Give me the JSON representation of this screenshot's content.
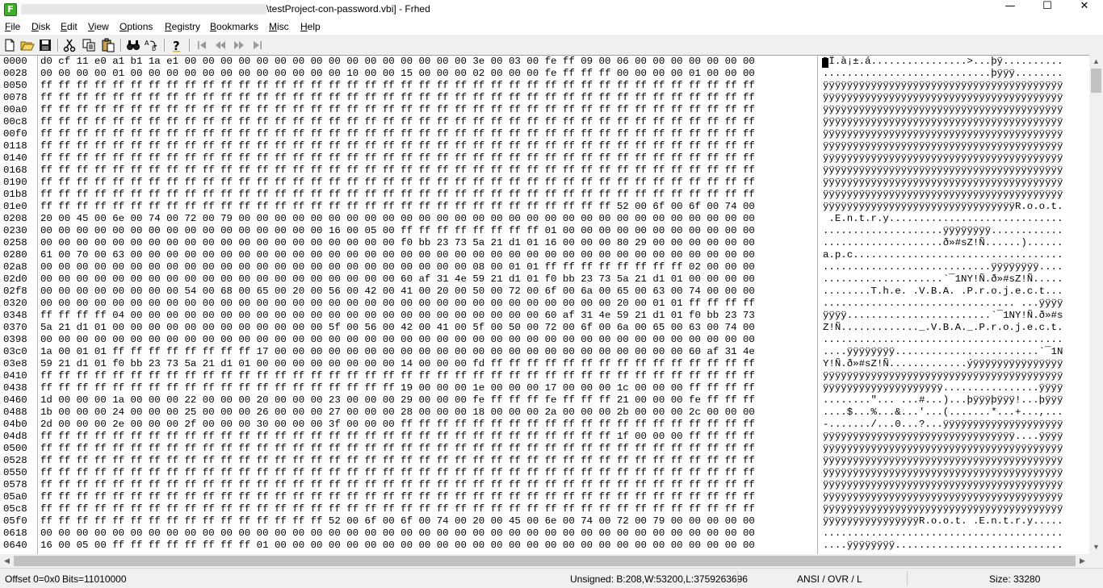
{
  "window": {
    "title": "\\testProject-con-password.vbi] - Frhed",
    "controls": {
      "minimize": "—",
      "maximize": "☐",
      "close": "✕"
    }
  },
  "menu": [
    {
      "label": "File",
      "u": "F",
      "rest": "ile"
    },
    {
      "label": "Disk",
      "u": "D",
      "rest": "isk"
    },
    {
      "label": "Edit",
      "u": "E",
      "rest": "dit"
    },
    {
      "label": "View",
      "u": "V",
      "rest": "iew"
    },
    {
      "label": "Options",
      "u": "O",
      "rest": "ptions"
    },
    {
      "label": "Registry",
      "u": "R",
      "rest": "egistry"
    },
    {
      "label": "Bookmarks",
      "u": "B",
      "rest": "ookmarks"
    },
    {
      "label": "Misc",
      "u": "M",
      "rest": "isc"
    },
    {
      "label": "Help",
      "u": "H",
      "rest": "elp"
    }
  ],
  "toolbar": [
    "new-file-icon",
    "open-folder-icon",
    "save-icon",
    "cut-icon",
    "copy-icon",
    "paste-icon",
    "find-icon",
    "replace-icon",
    "help-icon",
    "go-first-icon",
    "go-back-icon",
    "go-forward-icon",
    "go-last-icon"
  ],
  "hex": {
    "rows": [
      {
        "o": "0000",
        "h": "d0 cf 11 e0 a1 b1 1a e1 00 00 00 00 00 00 00 00 00 00 00 00 00 00 00 00 3e 00 03 00 fe ff 09 00 06 00 00 00 00 00 00 00",
        "a": "ÐÏ.à¡±.á................>...þÿ.........."
      },
      {
        "o": "0028",
        "h": "00 00 00 00 01 00 00 00 00 00 00 00 00 00 00 00 00 10 00 00 15 00 00 00 02 00 00 00 fe ff ff ff 00 00 00 00 01 00 00 00",
        "a": "............................þÿÿÿ........"
      },
      {
        "o": "0050",
        "h": "ff ff ff ff ff ff ff ff ff ff ff ff ff ff ff ff ff ff ff ff ff ff ff ff ff ff ff ff ff ff ff ff ff ff ff ff ff ff ff ff",
        "a": "ÿÿÿÿÿÿÿÿÿÿÿÿÿÿÿÿÿÿÿÿÿÿÿÿÿÿÿÿÿÿÿÿÿÿÿÿÿÿÿÿ"
      },
      {
        "o": "0078",
        "h": "ff ff ff ff ff ff ff ff ff ff ff ff ff ff ff ff ff ff ff ff ff ff ff ff ff ff ff ff ff ff ff ff ff ff ff ff ff ff ff ff",
        "a": "ÿÿÿÿÿÿÿÿÿÿÿÿÿÿÿÿÿÿÿÿÿÿÿÿÿÿÿÿÿÿÿÿÿÿÿÿÿÿÿÿ"
      },
      {
        "o": "00a0",
        "h": "ff ff ff ff ff ff ff ff ff ff ff ff ff ff ff ff ff ff ff ff ff ff ff ff ff ff ff ff ff ff ff ff ff ff ff ff ff ff ff ff",
        "a": "ÿÿÿÿÿÿÿÿÿÿÿÿÿÿÿÿÿÿÿÿÿÿÿÿÿÿÿÿÿÿÿÿÿÿÿÿÿÿÿÿ"
      },
      {
        "o": "00c8",
        "h": "ff ff ff ff ff ff ff ff ff ff ff ff ff ff ff ff ff ff ff ff ff ff ff ff ff ff ff ff ff ff ff ff ff ff ff ff ff ff ff ff",
        "a": "ÿÿÿÿÿÿÿÿÿÿÿÿÿÿÿÿÿÿÿÿÿÿÿÿÿÿÿÿÿÿÿÿÿÿÿÿÿÿÿÿ"
      },
      {
        "o": "00f0",
        "h": "ff ff ff ff ff ff ff ff ff ff ff ff ff ff ff ff ff ff ff ff ff ff ff ff ff ff ff ff ff ff ff ff ff ff ff ff ff ff ff ff",
        "a": "ÿÿÿÿÿÿÿÿÿÿÿÿÿÿÿÿÿÿÿÿÿÿÿÿÿÿÿÿÿÿÿÿÿÿÿÿÿÿÿÿ"
      },
      {
        "o": "0118",
        "h": "ff ff ff ff ff ff ff ff ff ff ff ff ff ff ff ff ff ff ff ff ff ff ff ff ff ff ff ff ff ff ff ff ff ff ff ff ff ff ff ff",
        "a": "ÿÿÿÿÿÿÿÿÿÿÿÿÿÿÿÿÿÿÿÿÿÿÿÿÿÿÿÿÿÿÿÿÿÿÿÿÿÿÿÿ"
      },
      {
        "o": "0140",
        "h": "ff ff ff ff ff ff ff ff ff ff ff ff ff ff ff ff ff ff ff ff ff ff ff ff ff ff ff ff ff ff ff ff ff ff ff ff ff ff ff ff",
        "a": "ÿÿÿÿÿÿÿÿÿÿÿÿÿÿÿÿÿÿÿÿÿÿÿÿÿÿÿÿÿÿÿÿÿÿÿÿÿÿÿÿ"
      },
      {
        "o": "0168",
        "h": "ff ff ff ff ff ff ff ff ff ff ff ff ff ff ff ff ff ff ff ff ff ff ff ff ff ff ff ff ff ff ff ff ff ff ff ff ff ff ff ff",
        "a": "ÿÿÿÿÿÿÿÿÿÿÿÿÿÿÿÿÿÿÿÿÿÿÿÿÿÿÿÿÿÿÿÿÿÿÿÿÿÿÿÿ"
      },
      {
        "o": "0190",
        "h": "ff ff ff ff ff ff ff ff ff ff ff ff ff ff ff ff ff ff ff ff ff ff ff ff ff ff ff ff ff ff ff ff ff ff ff ff ff ff ff ff",
        "a": "ÿÿÿÿÿÿÿÿÿÿÿÿÿÿÿÿÿÿÿÿÿÿÿÿÿÿÿÿÿÿÿÿÿÿÿÿÿÿÿÿ"
      },
      {
        "o": "01b8",
        "h": "ff ff ff ff ff ff ff ff ff ff ff ff ff ff ff ff ff ff ff ff ff ff ff ff ff ff ff ff ff ff ff ff ff ff ff ff ff ff ff ff",
        "a": "ÿÿÿÿÿÿÿÿÿÿÿÿÿÿÿÿÿÿÿÿÿÿÿÿÿÿÿÿÿÿÿÿÿÿÿÿÿÿÿÿ"
      },
      {
        "o": "01e0",
        "h": "ff ff ff ff ff ff ff ff ff ff ff ff ff ff ff ff ff ff ff ff ff ff ff ff ff ff ff ff ff ff ff ff 52 00 6f 00 6f 00 74 00",
        "a": "ÿÿÿÿÿÿÿÿÿÿÿÿÿÿÿÿÿÿÿÿÿÿÿÿÿÿÿÿÿÿÿÿR.o.o.t."
      },
      {
        "o": "0208",
        "h": "20 00 45 00 6e 00 74 00 72 00 79 00 00 00 00 00 00 00 00 00 00 00 00 00 00 00 00 00 00 00 00 00 00 00 00 00 00 00 00 00",
        "a": " .E.n.t.r.y............................."
      },
      {
        "o": "0230",
        "h": "00 00 00 00 00 00 00 00 00 00 00 00 00 00 00 00 16 00 05 00 ff ff ff ff ff ff ff ff 01 00 00 00 00 00 00 00 00 00 00 00",
        "a": "....................ÿÿÿÿÿÿÿÿ............"
      },
      {
        "o": "0258",
        "h": "00 00 00 00 00 00 00 00 00 00 00 00 00 00 00 00 00 00 00 00 f0 bb 23 73 5a 21 d1 01 16 00 00 00 80 29 00 00 00 00 00 00",
        "a": "....................ð»#sZ!Ñ......)......"
      },
      {
        "o": "0280",
        "h": "61 00 70 00 63 00 00 00 00 00 00 00 00 00 00 00 00 00 00 00 00 00 00 00 00 00 00 00 00 00 00 00 00 00 00 00 00 00 00 00",
        "a": "a.p.c..................................."
      },
      {
        "o": "02a8",
        "h": "00 00 00 00 00 00 00 00 00 00 00 00 00 00 00 00 00 00 00 00 00 00 00 00 08 00 01 01 ff ff ff ff ff ff ff ff 02 00 00 00",
        "a": "............................ÿÿÿÿÿÿÿÿ...."
      },
      {
        "o": "02d0",
        "h": "00 00 00 00 00 00 00 00 00 00 00 00 00 00 00 00 00 00 00 00 60 af 31 4e 59 21 d1 01 f0 bb 23 73 5a 21 d1 01 00 00 00 00",
        "a": "....................`¯1NY!Ñ.ð»#sZ!Ñ....."
      },
      {
        "o": "02f8",
        "h": "00 00 00 00 00 00 00 00 54 00 68 00 65 00 20 00 56 00 42 00 41 00 20 00 50 00 72 00 6f 00 6a 00 65 00 63 00 74 00 00 00",
        "a": "........T.h.e. .V.B.A. .P.r.o.j.e.c.t..."
      },
      {
        "o": "0320",
        "h": "00 00 00 00 00 00 00 00 00 00 00 00 00 00 00 00 00 00 00 00 00 00 00 00 00 00 00 00 00 00 00 00 20 00 01 01 ff ff ff ff",
        "a": "................................ ...ÿÿÿÿ"
      },
      {
        "o": "0348",
        "h": "ff ff ff ff 04 00 00 00 00 00 00 00 00 00 00 00 00 00 00 00 00 00 00 00 00 00 00 00 60 af 31 4e 59 21 d1 01 f0 bb 23 73",
        "a": "ÿÿÿÿ........................`¯1NY!Ñ.ð»#s"
      },
      {
        "o": "0370",
        "h": "5a 21 d1 01 00 00 00 00 00 00 00 00 00 00 00 00 5f 00 56 00 42 00 41 00 5f 00 50 00 72 00 6f 00 6a 00 65 00 63 00 74 00",
        "a": "Z!Ñ............._.V.B.A._.P.r.o.j.e.c.t."
      },
      {
        "o": "0398",
        "h": "00 00 00 00 00 00 00 00 00 00 00 00 00 00 00 00 00 00 00 00 00 00 00 00 00 00 00 00 00 00 00 00 00 00 00 00 00 00 00 00",
        "a": "........................................"
      },
      {
        "o": "03c0",
        "h": "1a 00 01 01 ff ff ff ff ff ff ff ff 17 00 00 00 00 00 00 00 00 00 00 00 00 00 00 00 00 00 00 00 00 00 00 00 60 af 31 4e",
        "a": "....ÿÿÿÿÿÿÿÿ........................`¯1N"
      },
      {
        "o": "03e8",
        "h": "59 21 d1 01 f0 bb 23 73 5a 21 d1 01 00 00 00 00 00 00 00 00 14 00 00 00 fd ff ff ff ff ff ff ff ff ff ff ff ff ff ff ff",
        "a": "Y!Ñ.ð»#sZ!Ñ.............ýÿÿÿÿÿÿÿÿÿÿÿÿÿÿÿ"
      },
      {
        "o": "0410",
        "h": "ff ff ff ff ff ff ff ff ff ff ff ff ff ff ff ff ff ff ff ff ff ff ff ff ff ff ff ff ff ff ff ff ff ff ff ff ff ff ff ff",
        "a": "ÿÿÿÿÿÿÿÿÿÿÿÿÿÿÿÿÿÿÿÿÿÿÿÿÿÿÿÿÿÿÿÿÿÿÿÿÿÿÿÿ"
      },
      {
        "o": "0438",
        "h": "ff ff ff ff ff ff ff ff ff ff ff ff ff ff ff ff ff ff ff ff 19 00 00 00 1e 00 00 00 17 00 00 00 1c 00 00 00 ff ff ff ff",
        "a": "ÿÿÿÿÿÿÿÿÿÿÿÿÿÿÿÿÿÿÿÿ................ÿÿÿÿ"
      },
      {
        "o": "0460",
        "h": "1d 00 00 00 1a 00 00 00 22 00 00 00 20 00 00 00 23 00 00 00 29 00 00 00 fe ff ff ff fe ff ff ff 21 00 00 00 fe ff ff ff",
        "a": "........\"... ...#...)...þÿÿÿþÿÿÿ!...þÿÿÿ"
      },
      {
        "o": "0488",
        "h": "1b 00 00 00 24 00 00 00 25 00 00 00 26 00 00 00 27 00 00 00 28 00 00 00 18 00 00 00 2a 00 00 00 2b 00 00 00 2c 00 00 00",
        "a": "....$...%...&...'...(.......*...+...,..."
      },
      {
        "o": "04b0",
        "h": "2d 00 00 00 2e 00 00 00 2f 00 00 00 30 00 00 00 3f 00 00 00 ff ff ff ff ff ff ff ff ff ff ff ff ff ff ff ff ff ff ff ff",
        "a": "-......./...0...?...ÿÿÿÿÿÿÿÿÿÿÿÿÿÿÿÿÿÿÿÿ"
      },
      {
        "o": "04d8",
        "h": "ff ff ff ff ff ff ff ff ff ff ff ff ff ff ff ff ff ff ff ff ff ff ff ff ff ff ff ff ff ff ff ff 1f 00 00 00 ff ff ff ff",
        "a": "ÿÿÿÿÿÿÿÿÿÿÿÿÿÿÿÿÿÿÿÿÿÿÿÿÿÿÿÿÿÿÿÿ....ÿÿÿÿ"
      },
      {
        "o": "0500",
        "h": "ff ff ff ff ff ff ff ff ff ff ff ff ff ff ff ff ff ff ff ff ff ff ff ff ff ff ff ff ff ff ff ff ff ff ff ff ff ff ff ff",
        "a": "ÿÿÿÿÿÿÿÿÿÿÿÿÿÿÿÿÿÿÿÿÿÿÿÿÿÿÿÿÿÿÿÿÿÿÿÿÿÿÿÿ"
      },
      {
        "o": "0528",
        "h": "ff ff ff ff ff ff ff ff ff ff ff ff ff ff ff ff ff ff ff ff ff ff ff ff ff ff ff ff ff ff ff ff ff ff ff ff ff ff ff ff",
        "a": "ÿÿÿÿÿÿÿÿÿÿÿÿÿÿÿÿÿÿÿÿÿÿÿÿÿÿÿÿÿÿÿÿÿÿÿÿÿÿÿÿ"
      },
      {
        "o": "0550",
        "h": "ff ff ff ff ff ff ff ff ff ff ff ff ff ff ff ff ff ff ff ff ff ff ff ff ff ff ff ff ff ff ff ff ff ff ff ff ff ff ff ff",
        "a": "ÿÿÿÿÿÿÿÿÿÿÿÿÿÿÿÿÿÿÿÿÿÿÿÿÿÿÿÿÿÿÿÿÿÿÿÿÿÿÿÿ"
      },
      {
        "o": "0578",
        "h": "ff ff ff ff ff ff ff ff ff ff ff ff ff ff ff ff ff ff ff ff ff ff ff ff ff ff ff ff ff ff ff ff ff ff ff ff ff ff ff ff",
        "a": "ÿÿÿÿÿÿÿÿÿÿÿÿÿÿÿÿÿÿÿÿÿÿÿÿÿÿÿÿÿÿÿÿÿÿÿÿÿÿÿÿ"
      },
      {
        "o": "05a0",
        "h": "ff ff ff ff ff ff ff ff ff ff ff ff ff ff ff ff ff ff ff ff ff ff ff ff ff ff ff ff ff ff ff ff ff ff ff ff ff ff ff ff",
        "a": "ÿÿÿÿÿÿÿÿÿÿÿÿÿÿÿÿÿÿÿÿÿÿÿÿÿÿÿÿÿÿÿÿÿÿÿÿÿÿÿÿ"
      },
      {
        "o": "05c8",
        "h": "ff ff ff ff ff ff ff ff ff ff ff ff ff ff ff ff ff ff ff ff ff ff ff ff ff ff ff ff ff ff ff ff ff ff ff ff ff ff ff ff",
        "a": "ÿÿÿÿÿÿÿÿÿÿÿÿÿÿÿÿÿÿÿÿÿÿÿÿÿÿÿÿÿÿÿÿÿÿÿÿÿÿÿÿ"
      },
      {
        "o": "05f0",
        "h": "ff ff ff ff ff ff ff ff ff ff ff ff ff ff ff ff 52 00 6f 00 6f 00 74 00 20 00 45 00 6e 00 74 00 72 00 79 00 00 00 00 00",
        "a": "ÿÿÿÿÿÿÿÿÿÿÿÿÿÿÿÿR.o.o.t. .E.n.t.r.y....."
      },
      {
        "o": "0618",
        "h": "00 00 00 00 00 00 00 00 00 00 00 00 00 00 00 00 00 00 00 00 00 00 00 00 00 00 00 00 00 00 00 00 00 00 00 00 00 00 00 00",
        "a": "........................................"
      },
      {
        "o": "0640",
        "h": "16 00 05 00 ff ff ff ff ff ff ff ff 01 00 00 00 00 00 00 00 00 00 00 00 00 00 00 00 00 00 00 00 00 00 00 00 00 00 00 00",
        "a": "....ÿÿÿÿÿÿÿÿ............................"
      }
    ]
  },
  "status": {
    "offset": "Offset 0=0x0",
    "bits": "Bits=11010000",
    "unsigned": "Unsigned: B:208,W:53200,L:3759263696",
    "mode": "ANSI / OVR / L",
    "size": "Size: 33280"
  }
}
